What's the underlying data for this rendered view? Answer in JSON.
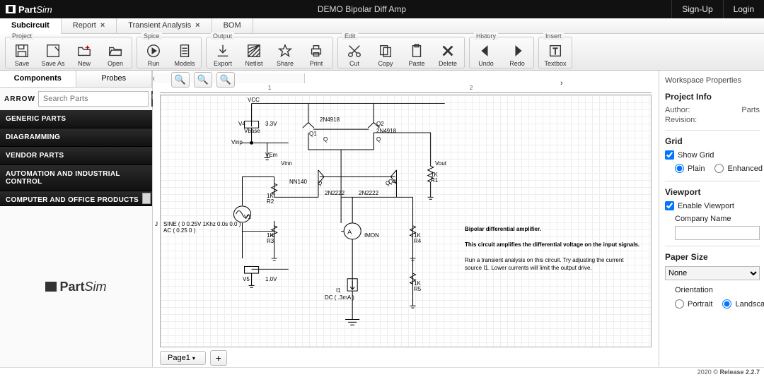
{
  "app": {
    "name_bold": "Part",
    "name_light": "Sim"
  },
  "title": "DEMO Bipolar Diff Amp",
  "auth": {
    "signup": "Sign-Up",
    "login": "Login"
  },
  "tabs": [
    {
      "label": "Subcircuit",
      "closable": false
    },
    {
      "label": "Report",
      "closable": true
    },
    {
      "label": "Transient Analysis",
      "closable": true
    },
    {
      "label": "BOM",
      "closable": false
    }
  ],
  "ribbon": {
    "project": {
      "label": "Project",
      "save": "Save",
      "saveas": "Save As",
      "new": "New",
      "open": "Open"
    },
    "spice": {
      "label": "Spice",
      "run": "Run",
      "models": "Models"
    },
    "output": {
      "label": "Output",
      "export": "Export",
      "netlist": "Netlist",
      "share": "Share",
      "print": "Print"
    },
    "edit": {
      "label": "Edit",
      "cut": "Cut",
      "copy": "Copy",
      "paste": "Paste",
      "delete": "Delete"
    },
    "history": {
      "label": "History",
      "undo": "Undo",
      "redo": "Redo"
    },
    "insert": {
      "label": "Insert",
      "textbox": "Textbox"
    }
  },
  "left": {
    "tabs": {
      "components": "Components",
      "probes": "Probes"
    },
    "search_placeholder": "Search Parts",
    "arrow_brand": "ARROW",
    "categories": [
      "GENERIC PARTS",
      "DIAGRAMMING",
      "VENDOR PARTS",
      "AUTOMATION AND INDUSTRIAL CONTROL",
      "COMPUTER AND OFFICE PRODUCTS"
    ]
  },
  "canvas": {
    "ruler": {
      "t1": "1",
      "t2": "2"
    },
    "page_label": "Page1",
    "side_label": "J",
    "labels": {
      "vcc": "VCC",
      "v4": "V4",
      "v4val": "3.3V",
      "vbase": "Vbase",
      "vinp": "Vinp",
      "vem": "VEm",
      "vinn": "Vinn",
      "q1a": "2N4918",
      "q1b": "Q1",
      "q1c": "Q",
      "q2a": "Q2",
      "q2b": "2N4918",
      "q2c": "Q",
      "vout": "Vout",
      "r1a": "1K",
      "r1b": "R1",
      "nn14": "NN140",
      "q3a": "Q",
      "q3b": "2N2222",
      "q3c": "2N2222",
      "q3d": "Q",
      "q4": "Q4",
      "v1": "V1",
      "v1desc": "SINE ( 0 0.25V 1Khz 0.0s 0.0 )\nAC ( 0.25 0 )",
      "r2a": "1K",
      "r2b": "R2",
      "r3a": "1K",
      "r3b": "R3",
      "imon": "IMON",
      "amp": "A",
      "r4a": "1K",
      "r4b": "R4",
      "v5": "V5",
      "v5val": "1.0V",
      "i1a": "I1",
      "i1b": "DC ( .3mA )",
      "r5a": "1K",
      "r5b": "R5"
    },
    "desc": {
      "h": "Bipolar differential amplifier.",
      "l1": "This circuit amplifies the differential voltage on the input signals.",
      "l2": "Run a transient analysis on this circuit. Try adjusting the current source I1. Lower currents will limit the output drive."
    }
  },
  "right": {
    "header": "Workspace Properties",
    "project_info": "Project Info",
    "author_k": "Author:",
    "author_v": "Parts",
    "revision_k": "Revision:",
    "grid": "Grid",
    "show_grid": "Show Grid",
    "plain": "Plain",
    "enhanced": "Enhanced",
    "viewport": "Viewport",
    "enable_viewport": "Enable Viewport",
    "company_name": "Company Name",
    "paper_size": "Paper Size",
    "paper_value": "None",
    "orientation": "Orientation",
    "portrait": "Portrait",
    "landscape": "Landscape"
  },
  "footer": {
    "year": "2020",
    "rel": "Release 2.2.7"
  }
}
